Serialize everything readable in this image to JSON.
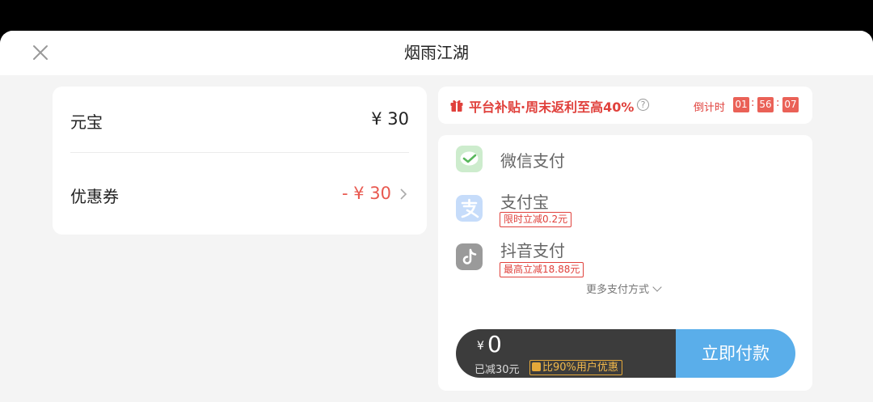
{
  "header": {
    "title": "烟雨江湖"
  },
  "order": {
    "item_label": "元宝",
    "item_price": "¥ 30",
    "coupon_label": "优惠券",
    "coupon_value": "- ¥ 30"
  },
  "promo": {
    "text": "平台补贴·周末返利至高40%",
    "countdown_label": "倒计时",
    "countdown": {
      "hours": "01",
      "minutes": "56",
      "seconds": "07",
      "separator": ":"
    }
  },
  "payment_methods": [
    {
      "name": "微信支付",
      "icon": "wechat-pay-icon"
    },
    {
      "name": "支付宝",
      "tag": "限时立减0.2元",
      "icon": "alipay-icon"
    },
    {
      "name": "抖音支付",
      "tag": "最高立减18.88元",
      "icon": "douyin-pay-icon"
    }
  ],
  "more_methods": "更多支付方式",
  "paybar": {
    "currency": "¥",
    "total": "0",
    "reduced": "已减30元",
    "compare": "比90%用户优惠",
    "button": "立即付款"
  },
  "colors": {
    "accent_red": "#e0413c",
    "pay_button": "#5aaeea",
    "dark_bar": "#3c3c3c"
  }
}
